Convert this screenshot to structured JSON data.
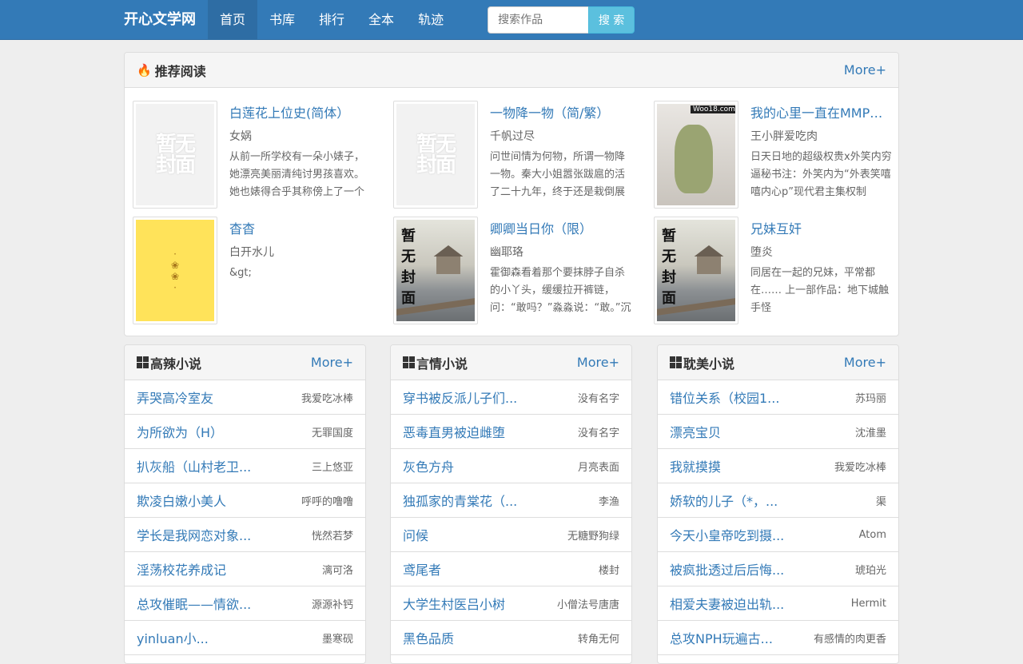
{
  "nav": {
    "brand": "开心文学网",
    "links": [
      "首页",
      "书库",
      "排行",
      "全本",
      "轨迹"
    ],
    "search_placeholder": "搜索作品",
    "search_button": "搜 索"
  },
  "recommend": {
    "title": "推荐阅读",
    "more": "More+",
    "books": [
      {
        "title": "白莲花上位史(简体）",
        "author": "女娲",
        "desc": "从前一所学校有一朵小婊子，她漂亮美丽清纯讨男孩喜欢。她也婊得合乎其称傍上了一个",
        "cover": "placeholder",
        "cover_text": "暂无封面"
      },
      {
        "title": "一物降一物（简/繁）",
        "author": "千帆过尽",
        "desc": "问世间情为何物，所谓一物降一物。秦大小姐嚣张跋扈的活了二十九年，终于还是栽倒展",
        "cover": "placeholder",
        "cover_text": "暂无封面"
      },
      {
        "title": "我的心里一直在MMP…",
        "author": "王小胖爱吃肉",
        "desc": "日天日地的超级权贵x外笑内穷逼秘书注：外笑内为“外表笑嘻嘻内心p”现代君主集权制",
        "cover": "photo",
        "cover_text": "Woo18.com"
      },
      {
        "title": "杳杳",
        "author": "白开水儿",
        "desc": "&gt;",
        "cover": "yellow",
        "cover_text": ""
      },
      {
        "title": "卿卿当日你（限）",
        "author": "幽耶珞",
        "desc": "霍御森看着那个要抹脖子自杀的小丫头，缓缓拉开裤链，问：“敢吗？”淼淼说：“敢。”沉",
        "cover": "pavilion",
        "cover_text": "暂无封面"
      },
      {
        "title": "兄妹互奸",
        "author": "堕炎",
        "desc": "同居在一起的兄妹，平常都在…… 上一部作品：地下城触手怪",
        "cover": "pavilion",
        "cover_text": "暂无封面"
      }
    ]
  },
  "categories": [
    {
      "title": "高辣小说",
      "more": "More+",
      "items": [
        {
          "name": "弄哭高冷室友",
          "author": "我爱吃冰棒"
        },
        {
          "name": "为所欲为（H）",
          "author": "无罪国度"
        },
        {
          "name": "扒灰船（山村老卫...",
          "author": "三上悠亚"
        },
        {
          "name": "欺凌白嫩小美人",
          "author": "呼呼的噜噜"
        },
        {
          "name": "学长是我网恋对象...",
          "author": "恍然若梦"
        },
        {
          "name": "淫荡校花养成记",
          "author": "漓可洛"
        },
        {
          "name": "总攻催眠——情欲...",
          "author": "源源补钙"
        },
        {
          "name": "yinluan小...",
          "author": "墨寒砚"
        }
      ]
    },
    {
      "title": "言情小说",
      "more": "More+",
      "items": [
        {
          "name": "穿书被反派儿子们...",
          "author": "没有名字"
        },
        {
          "name": "恶毒直男被迫雌堕",
          "author": "没有名字"
        },
        {
          "name": "灰色方舟",
          "author": "月亮表面"
        },
        {
          "name": "独孤家的青棠花（...",
          "author": "李渔"
        },
        {
          "name": "问候",
          "author": "无糖野狗绿"
        },
        {
          "name": "鸢尾者",
          "author": "楼封"
        },
        {
          "name": "大学生村医吕小树",
          "author": "小僧法号唐唐"
        },
        {
          "name": "黑色品质",
          "author": "转角无何"
        }
      ]
    },
    {
      "title": "耽美小说",
      "more": "More+",
      "items": [
        {
          "name": "错位关系（校园1...",
          "author": "苏玛丽"
        },
        {
          "name": "漂亮宝贝",
          "author": "沈淮墨"
        },
        {
          "name": "我就摸摸",
          "author": "我爱吃冰棒"
        },
        {
          "name": "娇软的儿子（*，...",
          "author": "渠"
        },
        {
          "name": "今天小皇帝吃到摄...",
          "author": "Atom"
        },
        {
          "name": "被疯批透过后后悔...",
          "author": "琥珀光"
        },
        {
          "name": "相爱夫妻被迫出轨...",
          "author": "Hermit"
        },
        {
          "name": "总攻NPH玩遍古...",
          "author": "有感情的肉更香"
        }
      ]
    }
  ]
}
